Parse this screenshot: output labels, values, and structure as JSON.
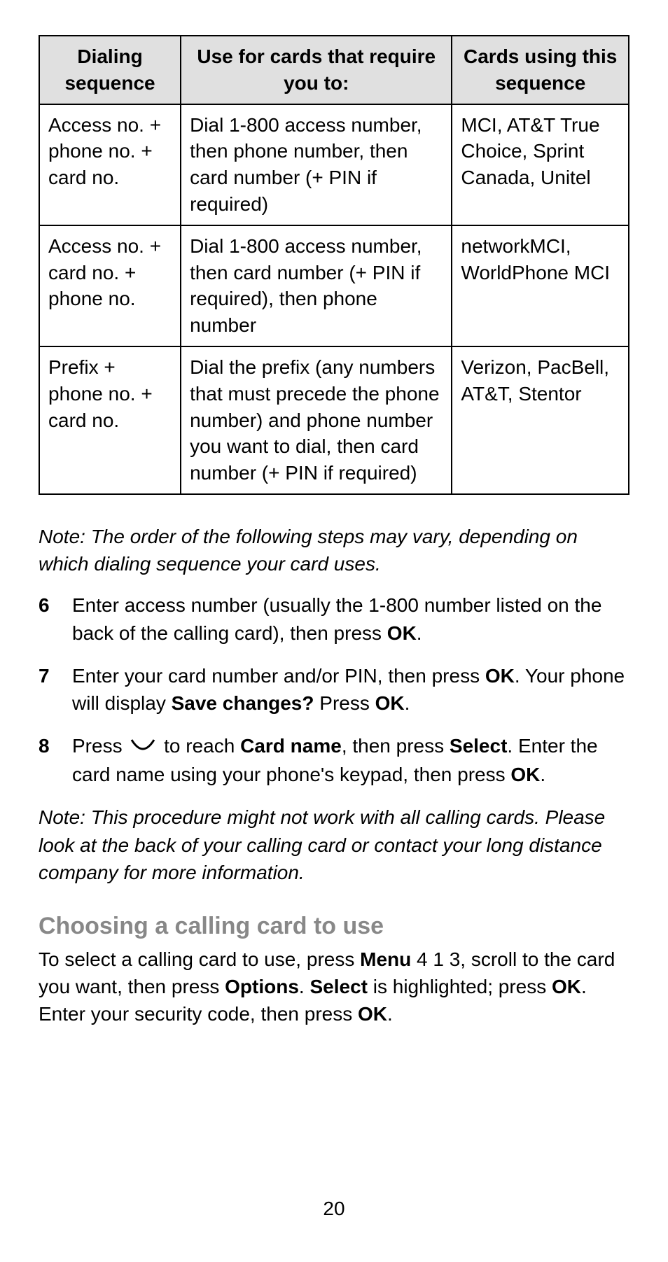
{
  "table": {
    "headers": [
      "Dialing sequence",
      "Use for cards that require you to:",
      "Cards using this sequence"
    ],
    "rows": [
      {
        "seq": "Access no. + phone no. + card no.",
        "use": "Dial 1-800 access number, then phone number, then card number (+ PIN if required)",
        "cards": "MCI, AT&T True Choice, Sprint Canada, Unitel"
      },
      {
        "seq": "Access no. + card no. + phone no.",
        "use": "Dial 1-800 access number, then card number (+ PIN if required), then phone number",
        "cards": "networkMCI, WorldPhone MCI"
      },
      {
        "seq": "Prefix + phone no. + card no.",
        "use": "Dial the prefix (any numbers that must precede the phone number) and phone number you want to dial, then card number (+ PIN if required)",
        "cards": "Verizon, PacBell, AT&T, Stentor"
      }
    ]
  },
  "note1": "Note:  The order of the following steps may vary, depending on which dialing sequence your card uses.",
  "steps": [
    {
      "n": "6",
      "pre": "Enter access number (usually the 1-800 number listed on the back of the calling card), then press ",
      "b1": "OK",
      "post": "."
    },
    {
      "n": "7",
      "pre": "Enter your card number and/or PIN, then press ",
      "b1": "OK",
      "mid": ". Your phone will display ",
      "b2": "Save changes?",
      "mid2": " Press ",
      "b3": "OK",
      "post": "."
    },
    {
      "n": "8",
      "pre": "Press ",
      "icon": true,
      "mid": " to reach ",
      "b1": "Card name",
      "mid2": ", then press ",
      "b2": "Select",
      "mid3": ". Enter the card name using your phone's keypad, then press ",
      "b3": "OK",
      "post": "."
    }
  ],
  "note2": "Note:  This procedure might not work with all calling cards. Please look at the back of your calling card or contact your long distance company for more information.",
  "heading": "Choosing a calling card to use",
  "para": {
    "t1": "To select a calling card to use, press ",
    "b1": "Menu",
    "t2": " 4 1 3, scroll to the card you want, then press ",
    "b2": "Options",
    "t3": ". ",
    "b3": "Select",
    "t4": " is highlighted; press ",
    "b4": "OK",
    "t5": ". Enter your security code, then press ",
    "b5": "OK",
    "t6": "."
  },
  "pageNum": "20"
}
